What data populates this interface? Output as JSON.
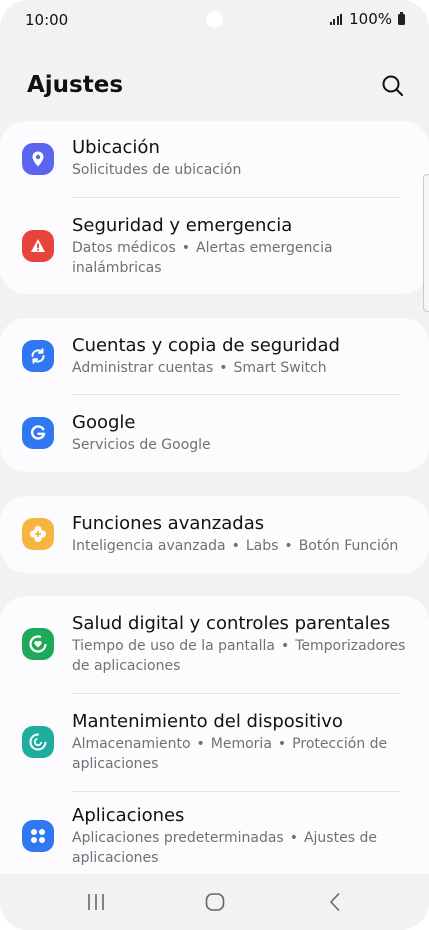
{
  "status_bar": {
    "time": "10:00",
    "battery_text": "100%"
  },
  "header": {
    "title": "Ajustes",
    "search_icon": "search-icon"
  },
  "colors": {
    "location": "#5b65f0",
    "security": "#e8443c",
    "accounts": "#2f78f2",
    "google": "#2f78f2",
    "advanced": "#f5b540",
    "digital": "#1faa5a",
    "maintenance": "#1fae9e",
    "apps": "#2f78f2"
  },
  "groups": [
    {
      "items": [
        {
          "title": "Ubicación",
          "subtitle": "Solicitudes de ubicación",
          "icon": "location-pin-icon"
        },
        {
          "title": "Seguridad y emergencia",
          "subtitle_1": "Datos médicos",
          "subtitle_2": "Alertas emergencia",
          "subtitle_3": "inalámbricas",
          "icon": "alert-icon"
        }
      ]
    },
    {
      "items": [
        {
          "title": "Cuentas y copia de seguridad",
          "subtitle_1": "Administrar cuentas",
          "subtitle_2": "Smart Switch",
          "icon": "sync-icon"
        },
        {
          "title": "Google",
          "subtitle": "Servicios de Google",
          "icon": "google-icon"
        }
      ]
    },
    {
      "items": [
        {
          "title": "Funciones avanzadas",
          "subtitle_1": "Inteligencia avanzada",
          "subtitle_2": "Labs",
          "subtitle_3": "Botón Función",
          "icon": "puzzle-plus-icon"
        }
      ]
    },
    {
      "items": [
        {
          "title": "Salud digital y controles parentales",
          "subtitle_1": "Tiempo de uso de la pantalla",
          "subtitle_2": "Temporizadores",
          "subtitle_3": "de aplicaciones",
          "icon": "heart-ring-icon"
        },
        {
          "title": "Mantenimiento del dispositivo",
          "subtitle_1": "Almacenamiento",
          "subtitle_2": "Memoria",
          "subtitle_3": "Protección de",
          "subtitle_4": "aplicaciones",
          "icon": "refresh-ring-icon"
        },
        {
          "title": "Aplicaciones",
          "subtitle_1": "Aplicaciones predeterminadas",
          "subtitle_2": "Ajustes de",
          "subtitle_3": "aplicaciones",
          "icon": "apps-grid-icon"
        }
      ]
    }
  ],
  "nav": {
    "recents": "recents-icon",
    "home": "home-icon",
    "back": "back-icon"
  }
}
